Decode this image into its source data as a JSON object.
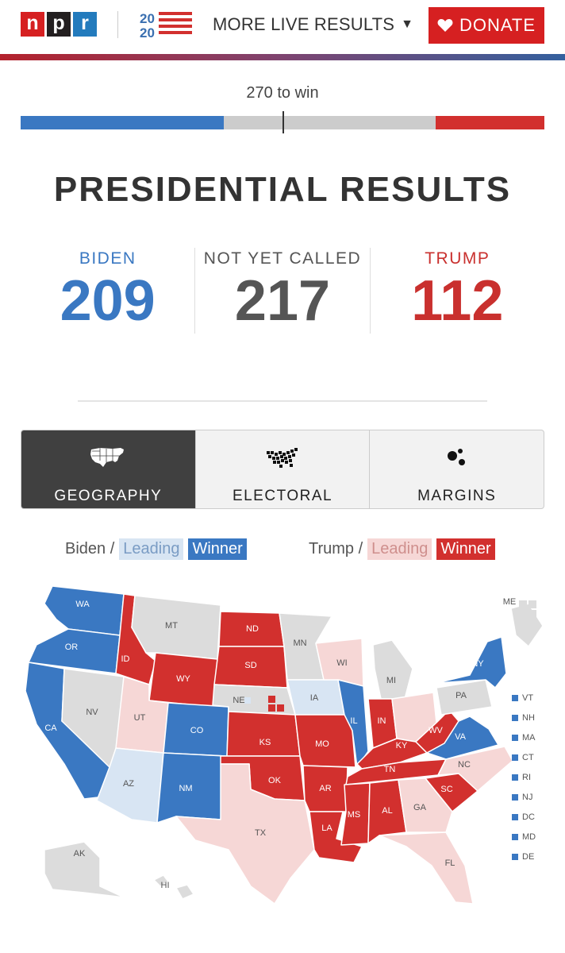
{
  "header": {
    "logo_letters": [
      "n",
      "p",
      "r"
    ],
    "more_live_label": "MORE LIVE RESULTS",
    "donate_label": "DONATE"
  },
  "bar": {
    "to_win_label": "270 to win",
    "biden_ev": 209,
    "trump_ev": 112,
    "total_ev": 538
  },
  "title": "PRESIDENTIAL RESULTS",
  "counts": {
    "biden_label": "BIDEN",
    "biden_value": "209",
    "not_called_label": "NOT YET CALLED",
    "not_called_value": "217",
    "trump_label": "TRUMP",
    "trump_value": "112"
  },
  "tabs": [
    {
      "label": "GEOGRAPHY",
      "icon": "us-map-icon",
      "active": true
    },
    {
      "label": "ELECTORAL",
      "icon": "cartogram-icon",
      "active": false
    },
    {
      "label": "MARGINS",
      "icon": "bubbles-icon",
      "active": false
    }
  ],
  "legend": {
    "biden_prefix": "Biden /",
    "trump_prefix": "Trump /",
    "leading_label": "Leading",
    "winner_label": "Winner"
  },
  "colors": {
    "biden_winner": "#3a78c2",
    "biden_leading": "#d8e5f3",
    "trump_winner": "#d2302e",
    "trump_leading": "#f6d7d6",
    "not_called": "#dcdcdc"
  },
  "map": {
    "states": {
      "WA": "biden_winner",
      "OR": "biden_winner",
      "CA": "biden_winner",
      "NV": "not_called",
      "ID": "trump_winner",
      "MT": "not_called",
      "WY": "trump_winner",
      "UT": "trump_leading",
      "AZ": "biden_leading",
      "CO": "biden_winner",
      "NM": "biden_winner",
      "ND": "trump_winner",
      "SD": "trump_winner",
      "NE": "not_called",
      "KS": "trump_winner",
      "OK": "trump_winner",
      "TX": "trump_leading",
      "MN": "not_called",
      "IA": "biden_leading",
      "MO": "trump_winner",
      "AR": "trump_winner",
      "LA": "trump_winner",
      "WI": "trump_leading",
      "IL": "biden_winner",
      "MS": "trump_winner",
      "MI": "not_called",
      "IN": "trump_winner",
      "KY": "trump_winner",
      "TN": "trump_winner",
      "AL": "trump_winner",
      "OH": "trump_leading",
      "WV": "trump_winner",
      "GA": "trump_leading",
      "FL": "trump_leading",
      "SC": "trump_winner",
      "NC": "trump_leading",
      "VA": "biden_winner",
      "PA": "not_called",
      "NY": "biden_winner",
      "ME": "not_called",
      "AK": "not_called",
      "HI": "not_called"
    },
    "small_states": [
      "VT",
      "NH",
      "MA",
      "CT",
      "RI",
      "NJ",
      "DC",
      "MD",
      "DE"
    ]
  }
}
